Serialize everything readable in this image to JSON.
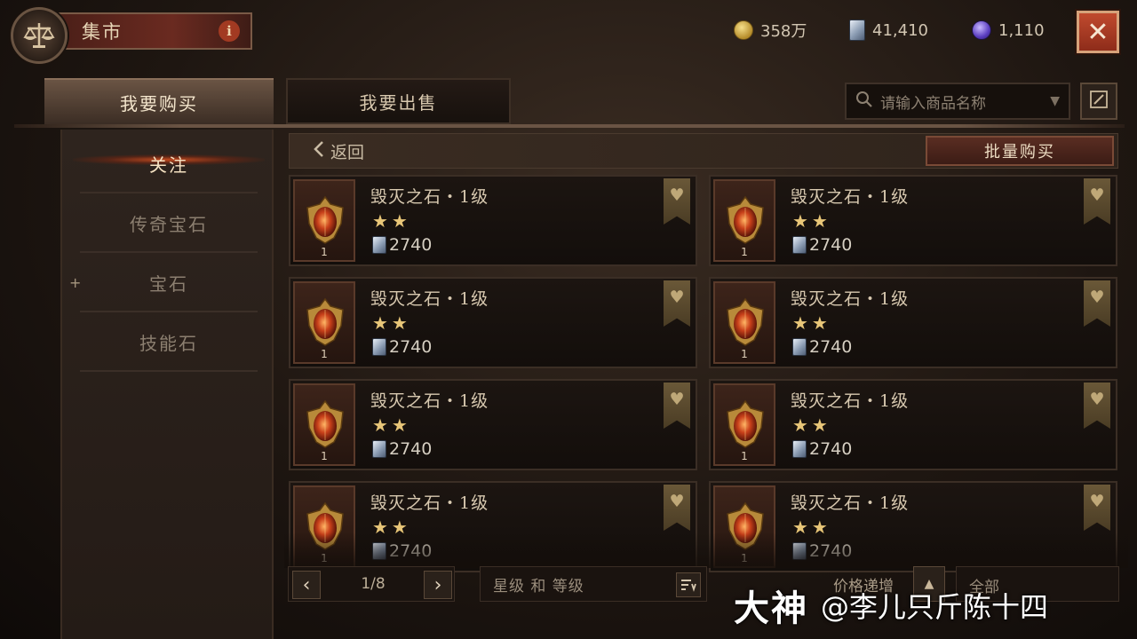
{
  "app": {
    "title": "集市",
    "info_label": "i",
    "close_label": "✕"
  },
  "currencies": [
    {
      "value": "358万",
      "icon": "gold-coin-icon"
    },
    {
      "value": "41,410",
      "icon": "blue-gem-icon"
    },
    {
      "value": "1,110",
      "icon": "purple-orb-icon"
    }
  ],
  "tabs": {
    "buy": "我要购买",
    "sell": "我要出售"
  },
  "search": {
    "placeholder": "请输入商品名称",
    "dropdown_arrow": "▼"
  },
  "sidebar": {
    "items": [
      {
        "label": "关注"
      },
      {
        "label": "传奇宝石"
      },
      {
        "label": "宝石"
      },
      {
        "label": "技能石"
      }
    ],
    "expand_marker": "+"
  },
  "content": {
    "back_label": "返回",
    "bulk_buy_label": "批量购买",
    "items": [
      {
        "name": "毁灭之石・1级",
        "stars": "★★",
        "price": "2740",
        "level": "1"
      },
      {
        "name": "毁灭之石・1级",
        "stars": "★★",
        "price": "2740",
        "level": "1"
      },
      {
        "name": "毁灭之石・1级",
        "stars": "★★",
        "price": "2740",
        "level": "1"
      },
      {
        "name": "毁灭之石・1级",
        "stars": "★★",
        "price": "2740",
        "level": "1"
      },
      {
        "name": "毁灭之石・1级",
        "stars": "★★",
        "price": "2740",
        "level": "1"
      },
      {
        "name": "毁灭之石・1级",
        "stars": "★★",
        "price": "2740",
        "level": "1"
      },
      {
        "name": "毁灭之石・1级",
        "stars": "★★",
        "price": "2740",
        "level": "1"
      },
      {
        "name": "毁灭之石・1级",
        "stars": "★★",
        "price": "2740",
        "level": "1"
      }
    ]
  },
  "footer": {
    "page_text": "1/8",
    "prev_label": "‹",
    "next_label": "›",
    "sort_label": "星级 和 等级",
    "price_sort_label": "价格递增",
    "price_sort_arrow": "▲",
    "filter_label": "全部"
  },
  "watermark": {
    "brand": "大神",
    "handle": "@李儿只斤陈十四"
  }
}
